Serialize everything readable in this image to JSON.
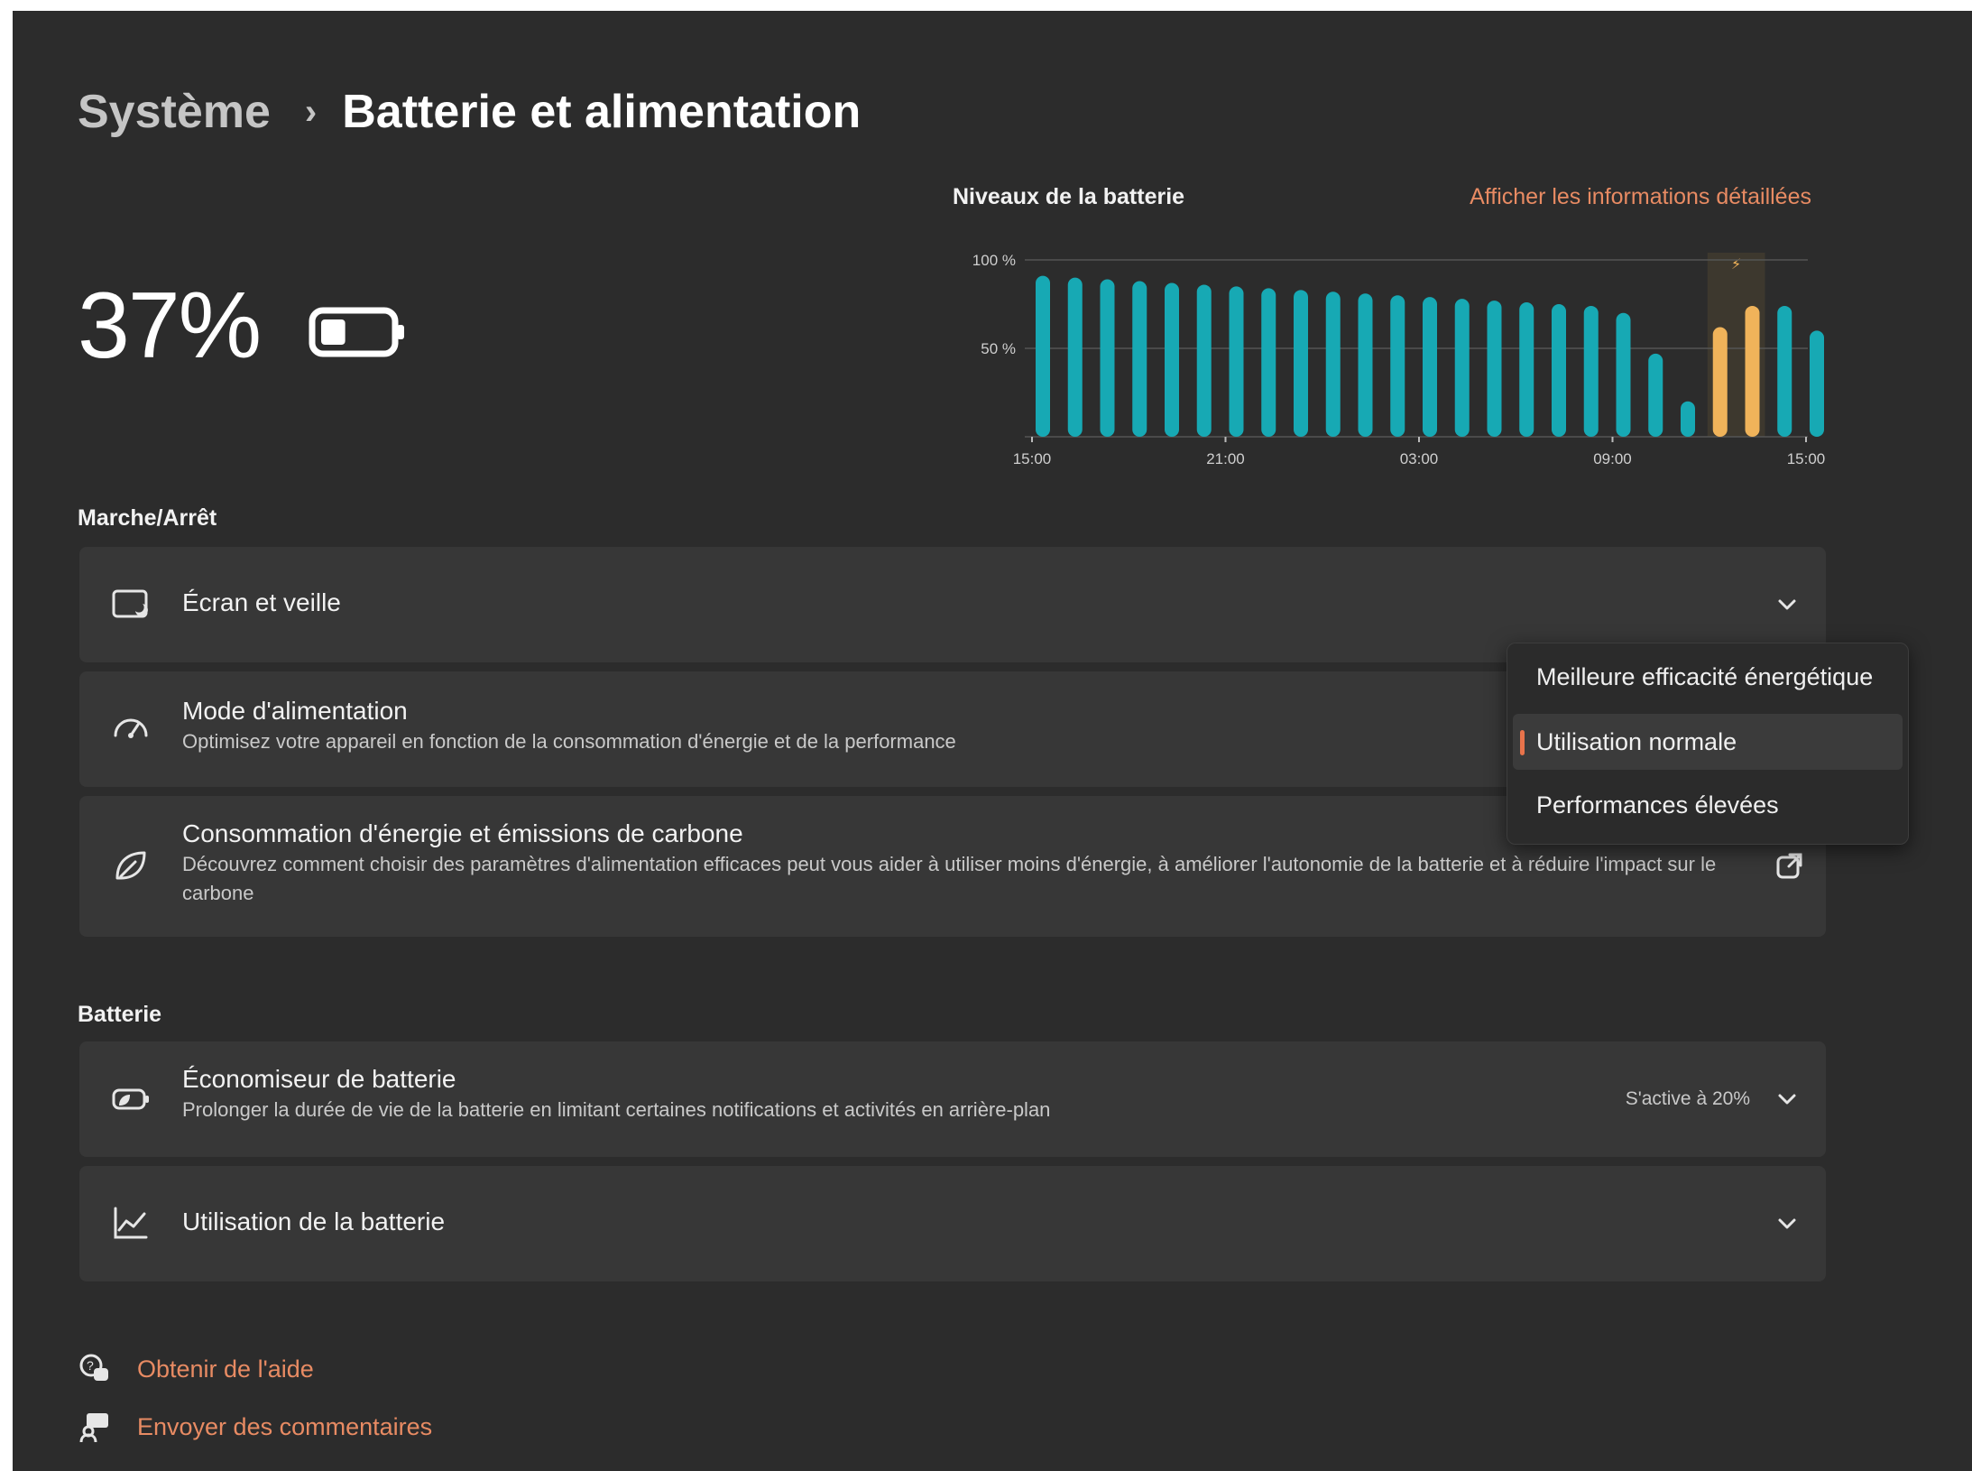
{
  "breadcrumb": {
    "parent": "Système",
    "separator": "›",
    "current": "Batterie et alimentation"
  },
  "battery": {
    "percent_label": "37%",
    "level": 0.37
  },
  "chart_header": {
    "title": "Niveaux de la batterie",
    "link": "Afficher les informations détaillées"
  },
  "chart_data": {
    "type": "bar",
    "ylim": [
      0,
      100
    ],
    "y_ticks": [
      "100 %",
      "50 %"
    ],
    "x_ticks": [
      "15:00",
      "21:00",
      "03:00",
      "09:00",
      "15:00"
    ],
    "values": [
      91,
      90,
      89,
      88,
      87,
      86,
      85,
      84,
      83,
      82,
      81,
      80,
      79,
      78,
      77,
      76,
      75,
      74,
      70,
      47,
      20,
      62,
      74,
      74,
      60
    ],
    "charging": [
      false,
      false,
      false,
      false,
      false,
      false,
      false,
      false,
      false,
      false,
      false,
      false,
      false,
      false,
      false,
      false,
      false,
      false,
      false,
      false,
      false,
      true,
      true,
      false,
      false
    ],
    "colors": {
      "discharge": "#17a9b4",
      "charging": "#f0b35a",
      "highlight": "#4a4130"
    },
    "grid": true
  },
  "sections": {
    "power": "Marche/Arrêt",
    "battery": "Batterie"
  },
  "cards": {
    "screen_sleep": {
      "title": "Écran et veille"
    },
    "power_mode": {
      "title": "Mode d'alimentation",
      "desc": "Optimisez votre appareil en fonction de la consommation d'énergie et de la performance"
    },
    "carbon": {
      "title": "Consommation d'énergie et émissions de carbone",
      "desc": "Découvrez comment choisir des paramètres d'alimentation efficaces peut vous aider à utiliser moins d'énergie, à améliorer l'autonomie de la batterie et à réduire l'impact sur le carbone"
    },
    "battery_saver": {
      "title": "Économiseur de batterie",
      "desc": "Prolonger la durée de vie de la batterie en limitant certaines notifications et activités en arrière-plan",
      "value": "S'active à 20%"
    },
    "battery_usage": {
      "title": "Utilisation de la batterie"
    }
  },
  "power_mode_menu": {
    "options": [
      "Meilleure efficacité énergétique",
      "Utilisation normale",
      "Performances élevées"
    ],
    "selected": "Utilisation normale"
  },
  "footer": {
    "help": "Obtenir de l'aide",
    "feedback": "Envoyer des commentaires"
  },
  "colors": {
    "accent": "#e8734b",
    "link": "#e88b63",
    "background": "#2c2c2c",
    "card": "#373737"
  }
}
